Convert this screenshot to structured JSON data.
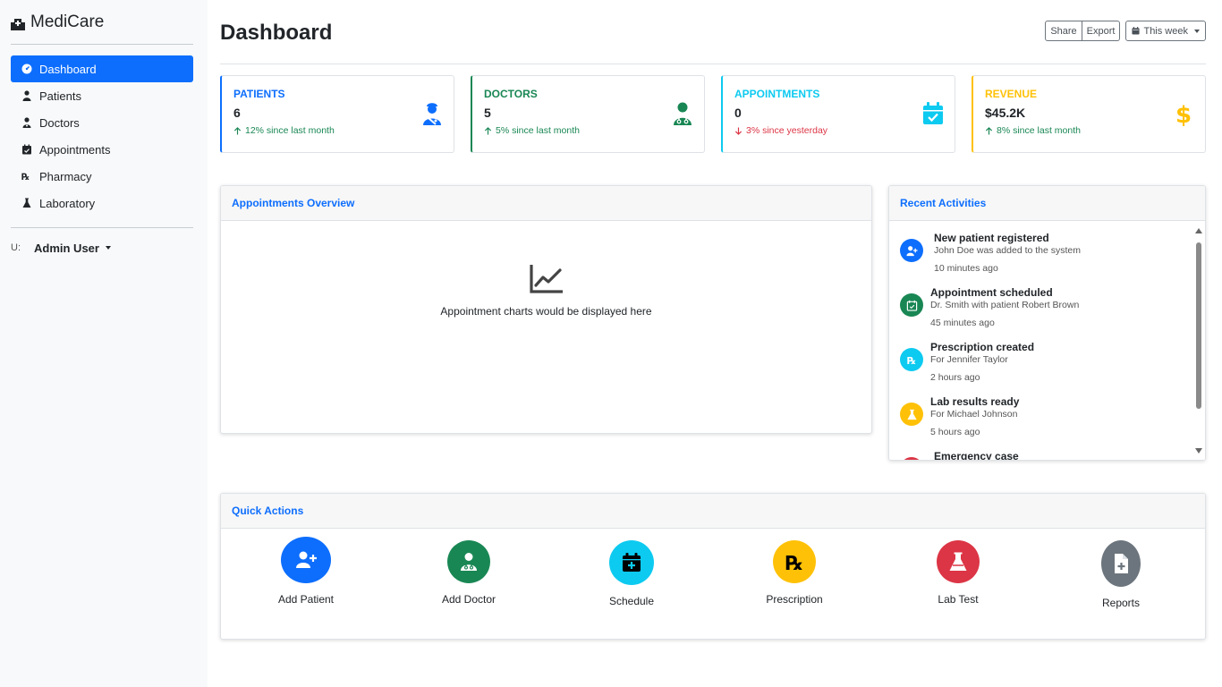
{
  "brand": {
    "name": "MediCare"
  },
  "sidebar": {
    "items": [
      {
        "label": "Dashboard",
        "icon": "gauge-icon",
        "active": true
      },
      {
        "label": "Patients",
        "icon": "user-injured-icon"
      },
      {
        "label": "Doctors",
        "icon": "user-doctor-icon"
      },
      {
        "label": "Appointments",
        "icon": "calendar-check-icon"
      },
      {
        "label": "Pharmacy",
        "icon": "prescription-icon"
      },
      {
        "label": "Laboratory",
        "icon": "flask-icon"
      }
    ],
    "user": {
      "name": "Admin User",
      "avatar_alt": "U:"
    }
  },
  "header": {
    "title": "Dashboard",
    "share_label": "Share",
    "export_label": "Export",
    "period_label": "This week"
  },
  "stats": [
    {
      "label": "PATIENTS",
      "value": "6",
      "trend": "12% since last month",
      "direction": "up",
      "color": "#0d6efd",
      "icon": "patient-icon"
    },
    {
      "label": "DOCTORS",
      "value": "5",
      "trend": "5% since last month",
      "direction": "up",
      "color": "#198754",
      "icon": "doctor-icon"
    },
    {
      "label": "APPOINTMENTS",
      "value": "0",
      "trend": "3% since yesterday",
      "direction": "down",
      "color": "#0dcaf0",
      "icon": "calendar-check-icon"
    },
    {
      "label": "REVENUE",
      "value": "$45.2K",
      "trend": "8% since last month",
      "direction": "up",
      "color": "#ffc107",
      "icon": "dollar-icon"
    }
  ],
  "overview": {
    "title": "Appointments Overview",
    "placeholder": "Appointment charts would be displayed here"
  },
  "activities": {
    "title": "Recent Activities",
    "items": [
      {
        "title": "New patient registered",
        "desc": "John Doe was added to the system",
        "time": "10 minutes ago",
        "color": "#0d6efd",
        "icon": "user-plus-icon"
      },
      {
        "title": "Appointment scheduled",
        "desc": "Dr. Smith with patient Robert Brown",
        "time": "45 minutes ago",
        "color": "#198754",
        "icon": "calendar-check-icon"
      },
      {
        "title": "Prescription created",
        "desc": "For Jennifer Taylor",
        "time": "2 hours ago",
        "color": "#0dcaf0",
        "icon": "prescription-icon"
      },
      {
        "title": "Lab results ready",
        "desc": "For Michael Johnson",
        "time": "5 hours ago",
        "color": "#ffc107",
        "icon": "flask-icon"
      },
      {
        "title": "Emergency case",
        "desc": "",
        "time": "",
        "color": "#dc3545",
        "icon": "ambulance-icon"
      }
    ]
  },
  "quick": {
    "title": "Quick Actions",
    "actions": [
      {
        "label": "Add Patient",
        "color": "#0d6efd",
        "icon": "user-plus-icon"
      },
      {
        "label": "Add Doctor",
        "color": "#198754",
        "icon": "user-doctor-icon"
      },
      {
        "label": "Schedule",
        "color": "#0dcaf0",
        "icon": "calendar-plus-icon"
      },
      {
        "label": "Prescription",
        "color": "#ffc107",
        "icon": "prescription-icon"
      },
      {
        "label": "Lab Test",
        "color": "#dc3545",
        "icon": "flask-icon"
      },
      {
        "label": "Reports",
        "color": "#6c757d",
        "icon": "file-medical-icon"
      }
    ]
  }
}
